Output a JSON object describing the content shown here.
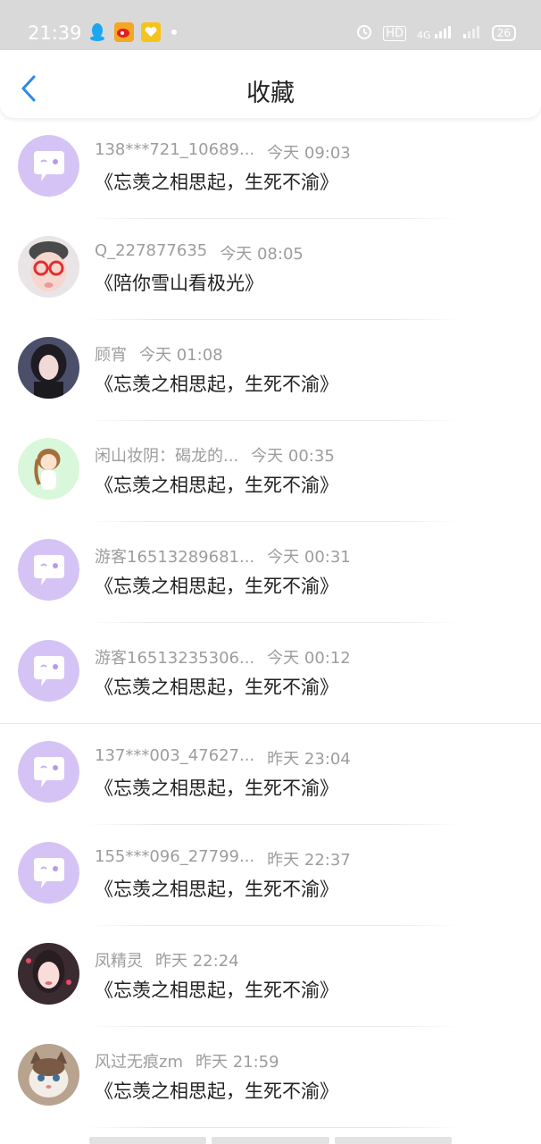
{
  "status_bar": {
    "time": "21:39",
    "left_icons": [
      "qq-icon",
      "weibo-icon",
      "heart-app-icon"
    ],
    "hd_label": "HD",
    "network_label": "4G",
    "battery": "26"
  },
  "header": {
    "title": "收藏",
    "back_icon": "chevron-left-icon",
    "accent": "#2a8be8"
  },
  "items": [
    {
      "name": "138***721_10689...",
      "time": "今天 09:03",
      "content": "《忘羡之相思起，生死不渝》",
      "avatar": "chat-bubble"
    },
    {
      "name": "Q_227877635",
      "time": "今天 08:05",
      "content": "《陪你雪山看极光》",
      "avatar": "baby-photo"
    },
    {
      "name": "顾宵",
      "time": "今天 01:08",
      "content": "《忘羡之相思起，生死不渝》",
      "avatar": "girl-photo"
    },
    {
      "name": "闲山妆阴：碣龙的...",
      "time": "今天 00:35",
      "content": "《忘羡之相思起，生死不渝》",
      "avatar": "cartoon-girl"
    },
    {
      "name": "游客16513289681...",
      "time": "今天 00:31",
      "content": "《忘羡之相思起，生死不渝》",
      "avatar": "chat-bubble"
    },
    {
      "name": "游客16513235306...",
      "time": "今天 00:12",
      "content": "《忘羡之相思起，生死不渝》",
      "avatar": "chat-bubble"
    },
    {
      "name": "137***003_47627...",
      "time": "昨天 23:04",
      "content": "《忘羡之相思起，生死不渝》",
      "avatar": "chat-bubble"
    },
    {
      "name": "155***096_27799...",
      "time": "昨天 22:37",
      "content": "《忘羡之相思起，生死不渝》",
      "avatar": "chat-bubble"
    },
    {
      "name": "凤精灵",
      "time": "昨天 22:24",
      "content": "《忘羡之相思起，生死不渝》",
      "avatar": "girl-selfie"
    },
    {
      "name": "风过无痕zm",
      "time": "昨天 21:59",
      "content": "《忘羡之相思起，生死不渝》",
      "avatar": "cat-photo"
    }
  ]
}
